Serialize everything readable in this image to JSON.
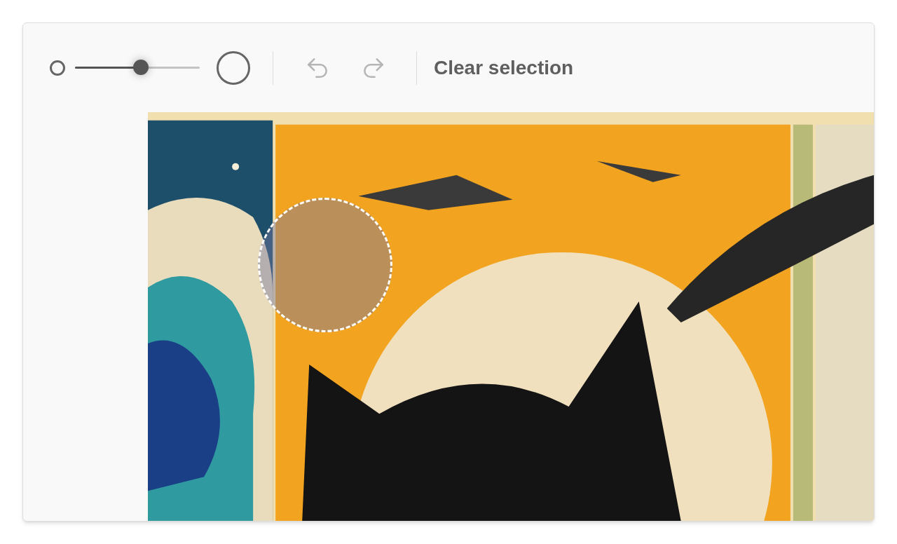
{
  "brush_size": {
    "level": 0.53
  },
  "undo": {
    "disabled": true
  },
  "redo": {
    "disabled": true
  },
  "clear_button": {
    "label": "Clear selection"
  },
  "canvas": {
    "kind": "picture",
    "selection": true
  }
}
